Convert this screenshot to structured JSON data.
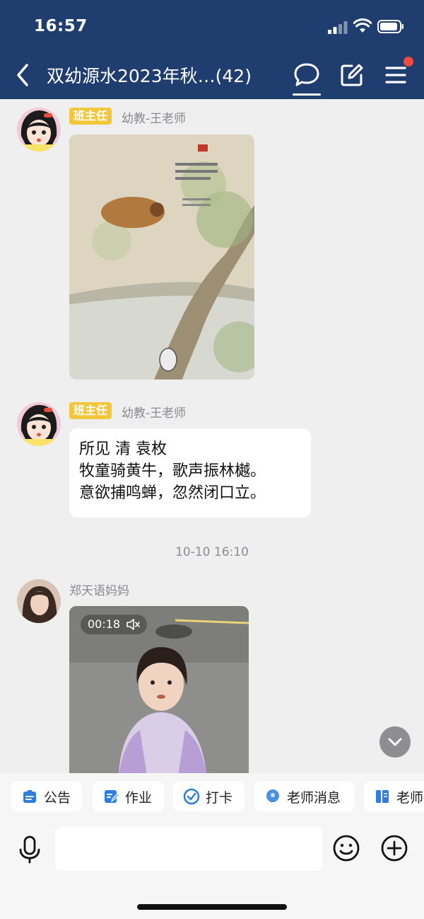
{
  "status_bar": {
    "time": "16:57"
  },
  "nav": {
    "title": "双幼源水2023年秋…(42)",
    "icons": [
      "back-chevron-icon",
      "chat-bubble-icon",
      "edit-icon",
      "menu-icon"
    ],
    "accent_color": "#1f3d6e",
    "notification_dot_color": "#f04a3e"
  },
  "messages": [
    {
      "role_badge": "班主任",
      "sender": "幼教-王老师",
      "type": "image"
    },
    {
      "role_badge": "班主任",
      "sender": "幼教-王老师",
      "type": "text",
      "lines": [
        "所见 清 袁枚",
        "牧童骑黄牛，歌声振林樾。",
        "意欲捕鸣蝉，忽然闭口立。"
      ]
    },
    {
      "timestamp": "10-10 16:10"
    },
    {
      "sender": "郑天语妈妈",
      "type": "video",
      "duration": "00:18",
      "muted": true
    }
  ],
  "quick_actions": [
    {
      "label": "公告",
      "icon": "notice-icon"
    },
    {
      "label": "作业",
      "icon": "homework-icon"
    },
    {
      "label": "打卡",
      "icon": "checkin-icon"
    },
    {
      "label": "老师消息",
      "icon": "teacher-message-icon"
    },
    {
      "label": "老师",
      "icon": "book-icon"
    }
  ],
  "composer": {
    "placeholder": ""
  }
}
